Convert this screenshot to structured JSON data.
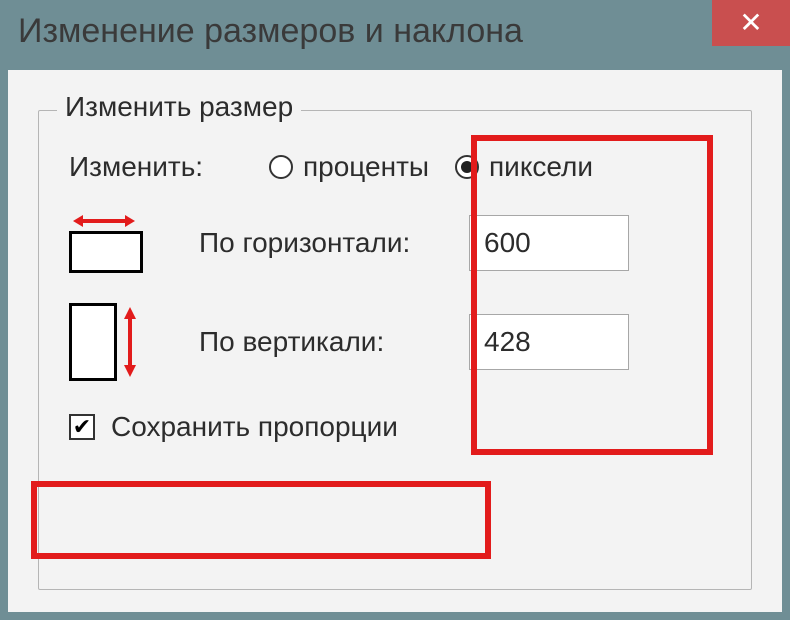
{
  "dialog": {
    "title": "Изменение размеров и наклона",
    "close": "✕"
  },
  "resize": {
    "legend": "Изменить размер",
    "change_label": "Изменить:",
    "unit_percent": "проценты",
    "unit_pixels": "пиксели",
    "horizontal_label": "По горизонтали:",
    "horizontal_value": "600",
    "vertical_label": "По вертикали:",
    "vertical_value": "428",
    "keep_ratio_label": "Сохранить пропорции"
  }
}
